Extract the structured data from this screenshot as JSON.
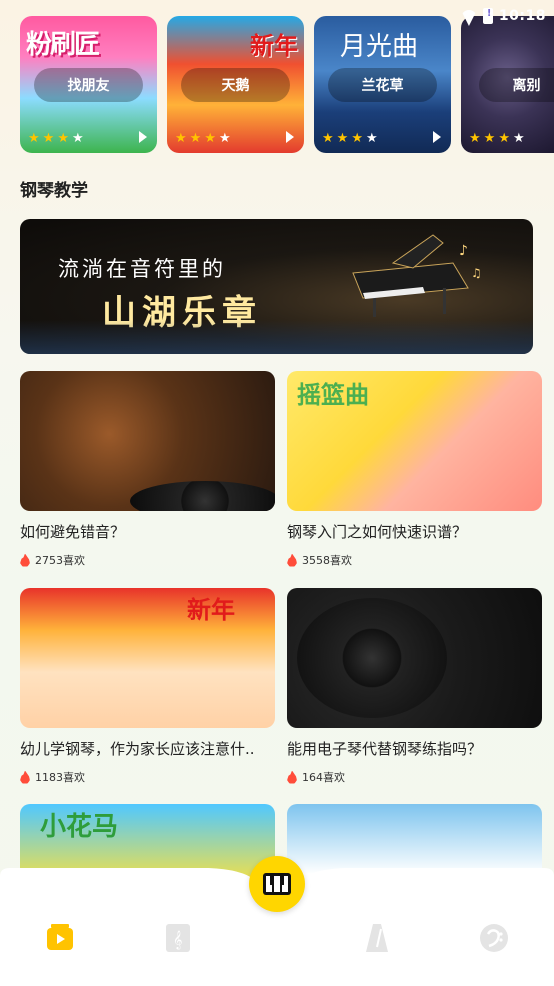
{
  "status_bar": {
    "time": "10:18"
  },
  "songs": [
    {
      "title": "找朋友",
      "art_text": "粉刷匠",
      "stars": 3,
      "max_stars": 4
    },
    {
      "title": "天鹅",
      "art_text": "新年",
      "stars": 3,
      "max_stars": 4
    },
    {
      "title": "兰花草",
      "art_text": "月光曲",
      "stars": 3,
      "max_stars": 4
    },
    {
      "title": "离别",
      "art_text": "",
      "stars": 3,
      "max_stars": 4
    }
  ],
  "section": {
    "title": "钢琴教学"
  },
  "banner": {
    "line1": "流淌在音符里的",
    "line2": "山湖乐章"
  },
  "lessons": [
    {
      "title": "如何避免错音？",
      "likes": "2753喜欢",
      "thumb_text": ""
    },
    {
      "title": "钢琴入门之如何快速识谱？",
      "likes": "3558喜欢",
      "thumb_text": "摇篮曲"
    },
    {
      "title": "幼儿学钢琴，作为家长应该注意什..",
      "likes": "1183喜欢",
      "thumb_text": "新年"
    },
    {
      "title": "能用电子琴代替钢琴练指吗？",
      "likes": "164喜欢",
      "thumb_text": ""
    },
    {
      "title": "",
      "likes": "",
      "thumb_text": "小花马"
    },
    {
      "title": "",
      "likes": "",
      "thumb_text": ""
    }
  ],
  "bottom_nav": {
    "active": "video",
    "items": [
      "video-tab",
      "sheet-music-tab",
      "piano-center",
      "metronome-tab",
      "bass-clef-tab"
    ]
  },
  "colors": {
    "accent": "#ffd600",
    "star": "#ffc400",
    "flame": "#ff4d3a"
  }
}
